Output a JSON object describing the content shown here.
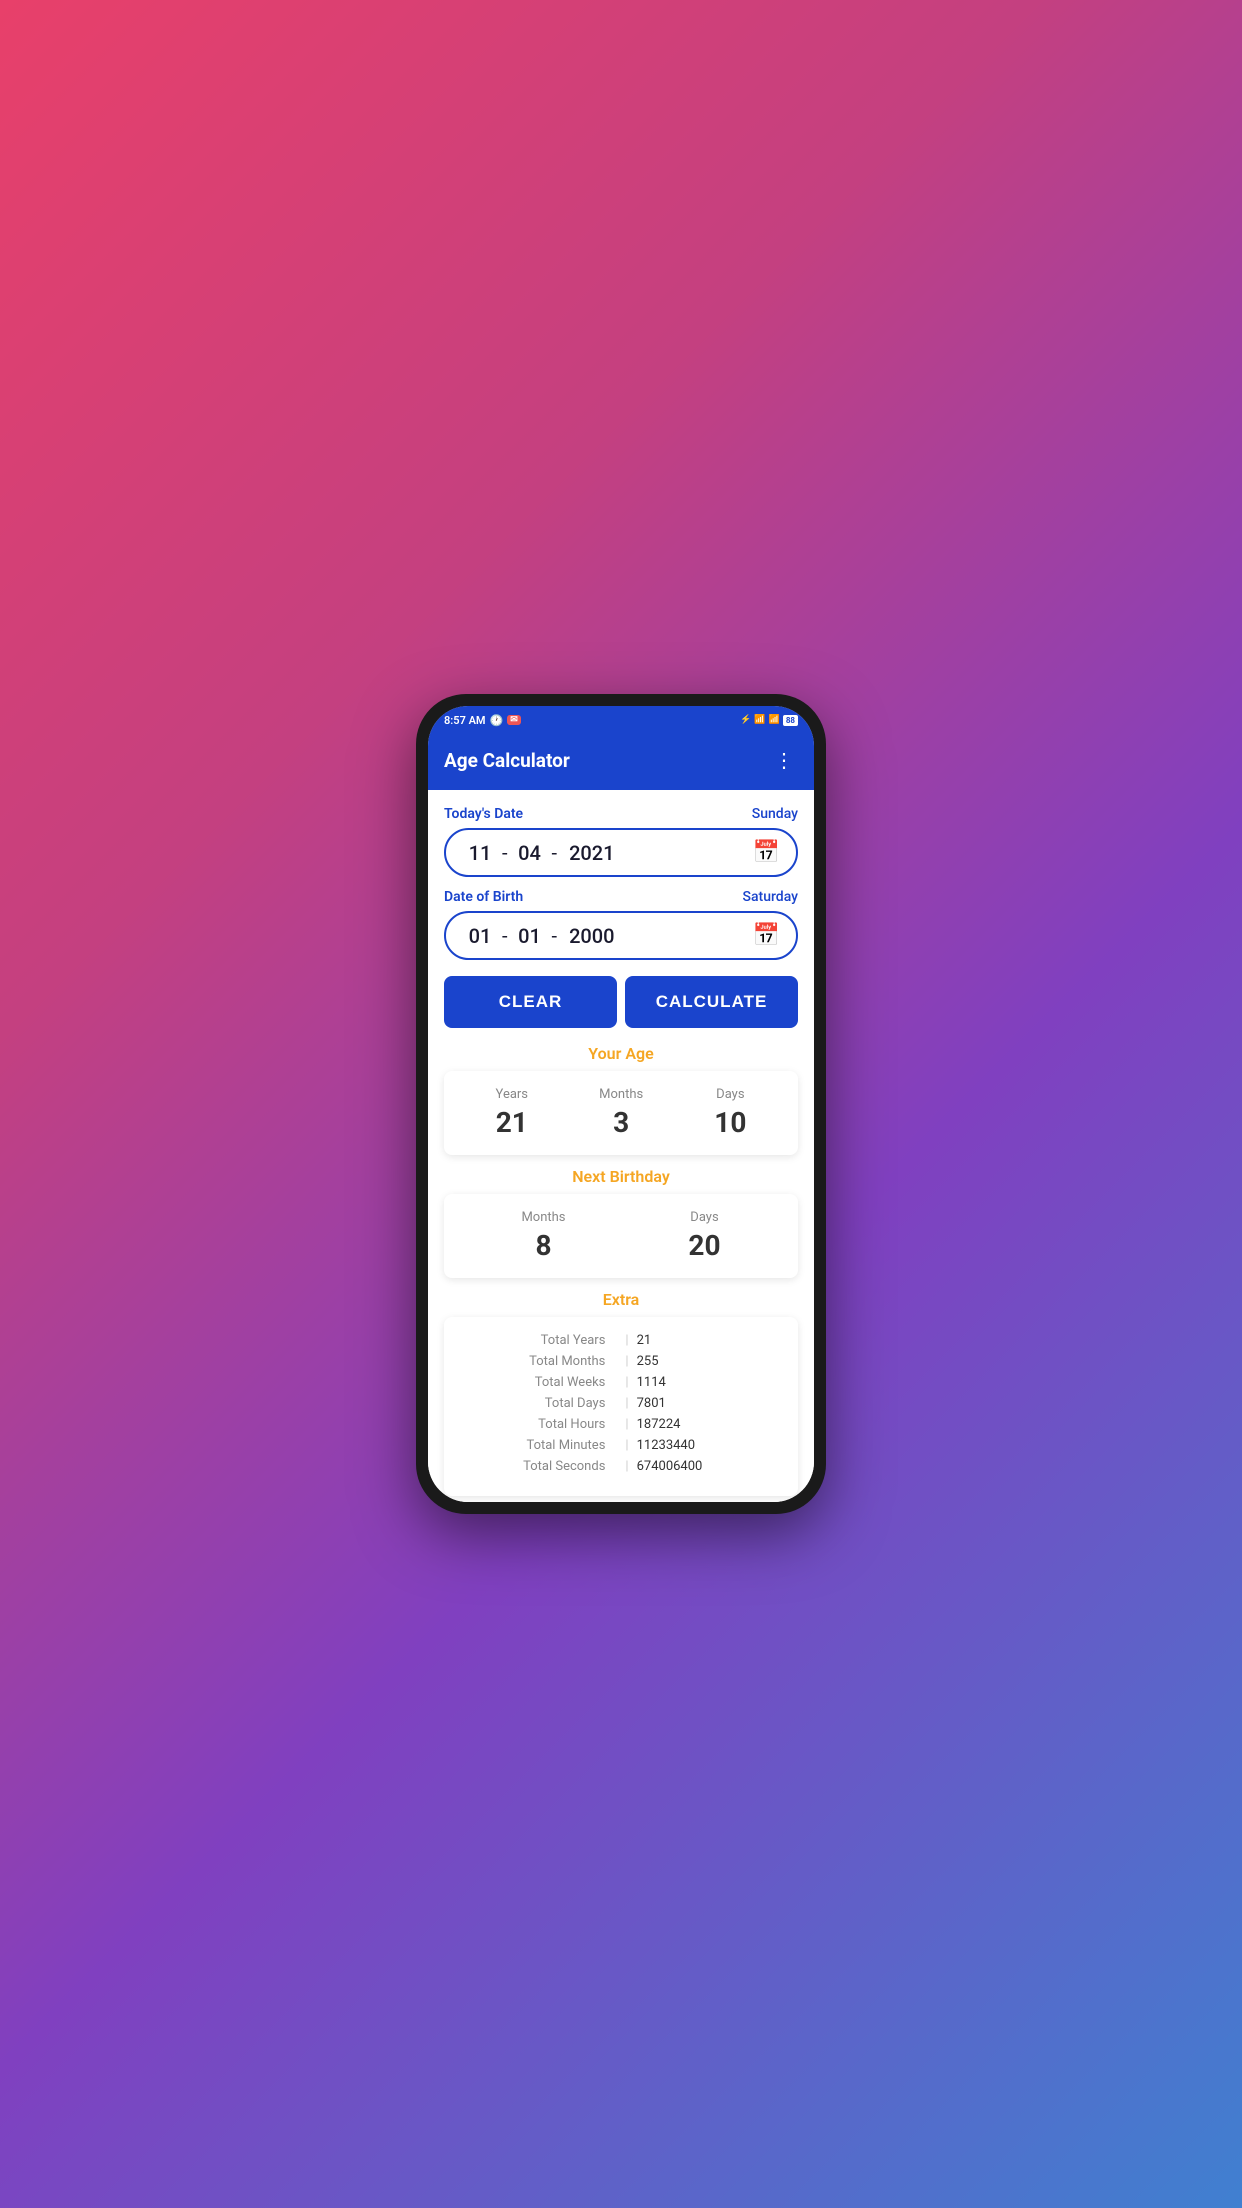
{
  "statusBar": {
    "time": "8:57 AM",
    "battery": "88"
  },
  "appBar": {
    "title": "Age Calculator",
    "menuIcon": "⋮"
  },
  "todaysDate": {
    "label": "Today's Date",
    "dayOfWeek": "Sunday",
    "day": "11",
    "month": "04",
    "year": "2021"
  },
  "dateOfBirth": {
    "label": "Date of Birth",
    "dayOfWeek": "Saturday",
    "day": "01",
    "month": "01",
    "year": "2000"
  },
  "buttons": {
    "clear": "CLEAR",
    "calculate": "CALCULATE"
  },
  "yourAge": {
    "sectionTitle": "Your Age",
    "yearsLabel": "Years",
    "yearsValue": "21",
    "monthsLabel": "Months",
    "monthsValue": "3",
    "daysLabel": "Days",
    "daysValue": "10"
  },
  "nextBirthday": {
    "sectionTitle": "Next Birthday",
    "monthsLabel": "Months",
    "monthsValue": "8",
    "daysLabel": "Days",
    "daysValue": "20"
  },
  "extra": {
    "sectionTitle": "Extra",
    "rows": [
      {
        "label": "Total Years",
        "value": "21"
      },
      {
        "label": "Total Months",
        "value": "255"
      },
      {
        "label": "Total Weeks",
        "value": "1114"
      },
      {
        "label": "Total Days",
        "value": "7801"
      },
      {
        "label": "Total Hours",
        "value": "187224"
      },
      {
        "label": "Total Minutes",
        "value": "11233440"
      },
      {
        "label": "Total Seconds",
        "value": "674006400"
      }
    ]
  }
}
